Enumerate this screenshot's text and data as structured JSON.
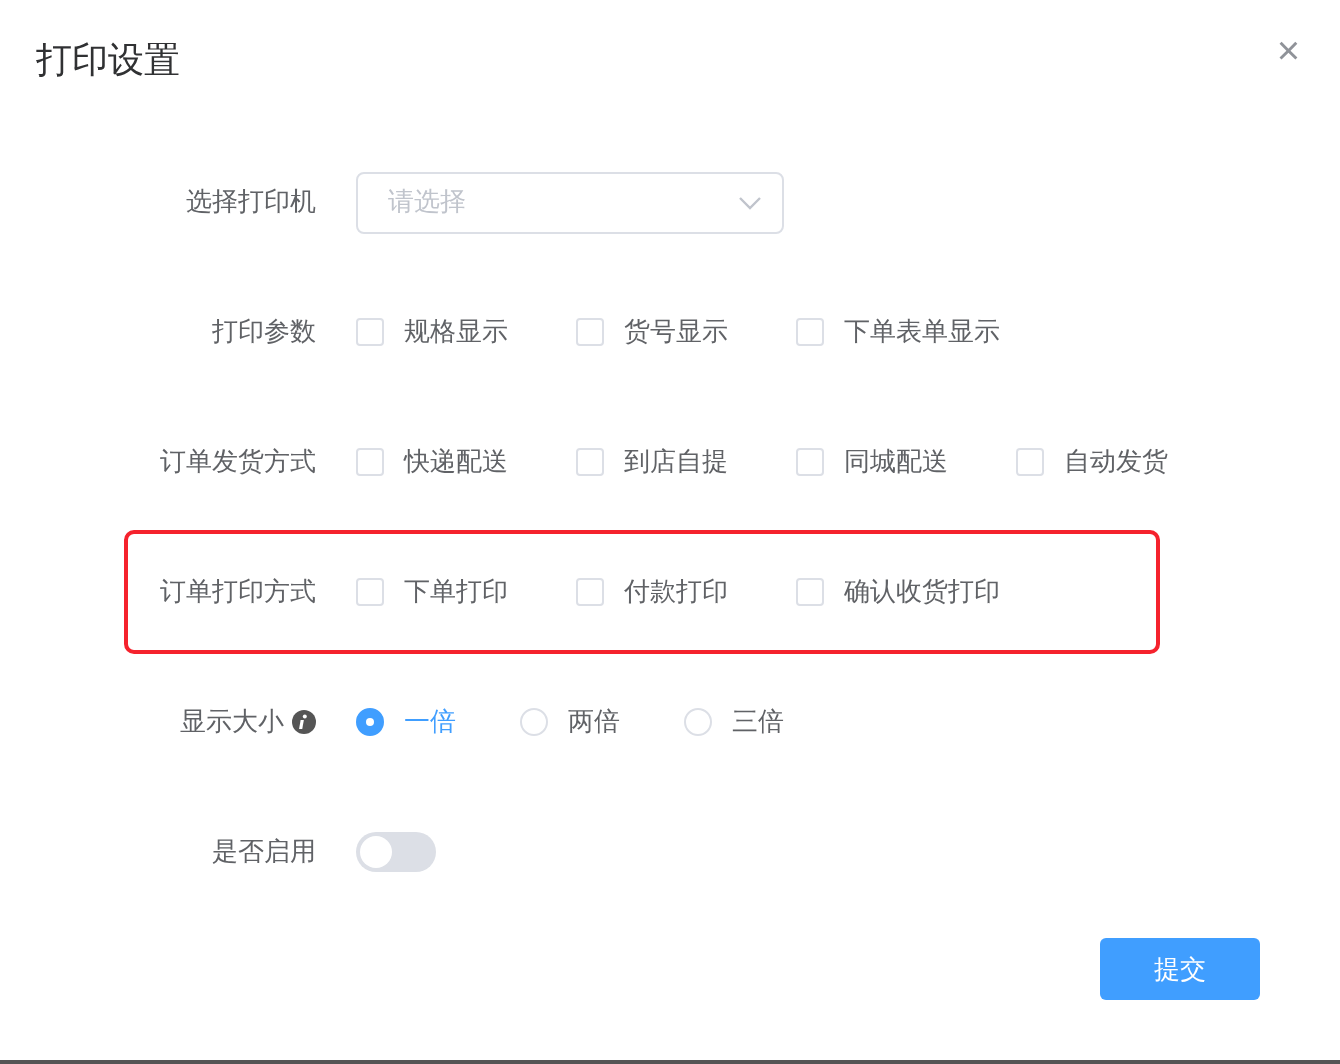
{
  "dialog": {
    "title": "打印设置",
    "close": "×"
  },
  "rows": [
    {
      "kind": "select",
      "label": "选择打印机",
      "placeholder": "请选择",
      "highlighted": false
    },
    {
      "kind": "checkbox",
      "label": "打印参数",
      "highlighted": false,
      "options": [
        {
          "label": "规格显示",
          "checked": false
        },
        {
          "label": "货号显示",
          "checked": false
        },
        {
          "label": "下单表单显示",
          "checked": false
        }
      ]
    },
    {
      "kind": "checkbox",
      "label": "订单发货方式",
      "highlighted": false,
      "options": [
        {
          "label": "快递配送",
          "checked": false
        },
        {
          "label": "到店自提",
          "checked": false
        },
        {
          "label": "同城配送",
          "checked": false
        },
        {
          "label": "自动发货",
          "checked": false
        }
      ]
    },
    {
      "kind": "checkbox",
      "label": "订单打印方式",
      "highlighted": true,
      "options": [
        {
          "label": "下单打印",
          "checked": false
        },
        {
          "label": "付款打印",
          "checked": false
        },
        {
          "label": "确认收货打印",
          "checked": false
        }
      ]
    },
    {
      "kind": "radio",
      "label": "显示大小",
      "info_icon": true,
      "highlighted": false,
      "options": [
        {
          "label": "一倍",
          "selected": true
        },
        {
          "label": "两倍",
          "selected": false
        },
        {
          "label": "三倍",
          "selected": false
        }
      ]
    },
    {
      "kind": "switch",
      "label": "是否启用",
      "on": false,
      "highlighted": false
    }
  ],
  "submit": "提交"
}
